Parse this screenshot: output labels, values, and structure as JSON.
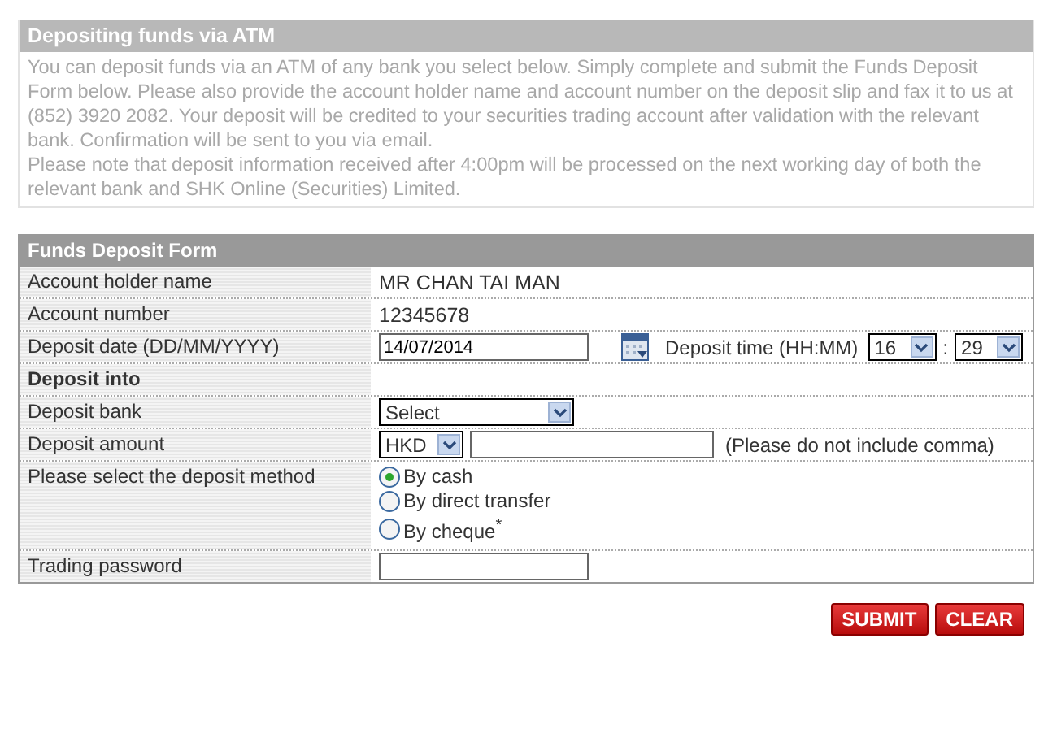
{
  "notice": {
    "title": "Depositing funds via ATM",
    "paragraphs": [
      "You can deposit funds via an ATM of any bank you select below. Simply complete and submit the Funds Deposit Form below. Please also provide the account holder name and account number on the deposit slip and fax it to us at (852) 3920 2082. Your deposit will be credited to your securities trading account after validation with the relevant bank. Confirmation will be sent to you via email.",
      "Please note that deposit information received after 4:00pm will be processed on the next working day of both the relevant bank and SHK Online (Securities) Limited."
    ]
  },
  "form": {
    "title": "Funds Deposit Form",
    "rows": [
      {
        "kind": "text",
        "label": "Account holder name",
        "value": "MR CHAN TAI MAN"
      },
      {
        "kind": "text",
        "label": "Account number",
        "value": "12345678"
      },
      {
        "kind": "datetime",
        "label": "Deposit date (DD/MM/YYYY)",
        "date": "14/07/2014",
        "time_label": "Deposit time (HH:MM)",
        "hour": "16",
        "separator": ":",
        "minute": "29"
      },
      {
        "kind": "section",
        "label": "Deposit into"
      },
      {
        "kind": "select",
        "label": "Deposit bank",
        "value": "Select"
      },
      {
        "kind": "amount",
        "label": "Deposit amount",
        "currency": "HKD",
        "note": "(Please do not include comma)"
      },
      {
        "kind": "radio",
        "label": "Please select the deposit method",
        "options": [
          {
            "label": "By cash",
            "selected": true
          },
          {
            "label": "By direct transfer",
            "selected": false
          },
          {
            "label": "By cheque$^{*}$",
            "selected": false
          }
        ]
      },
      {
        "kind": "password",
        "label": "Trading password"
      }
    ]
  },
  "buttons": [
    "SUBMIT",
    "CLEAR"
  ]
}
